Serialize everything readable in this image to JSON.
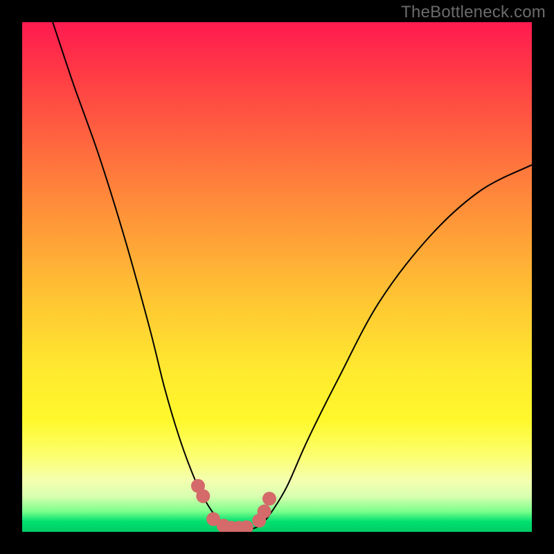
{
  "watermark": "TheBottleneck.com",
  "chart_data": {
    "type": "line",
    "title": "",
    "xlabel": "",
    "ylabel": "",
    "xlim": [
      0,
      100
    ],
    "ylim": [
      0,
      100
    ],
    "background_gradient": {
      "stops": [
        {
          "pos": 0.0,
          "color": "#ff1a50"
        },
        {
          "pos": 0.25,
          "color": "#ff6b3e"
        },
        {
          "pos": 0.55,
          "color": "#ffc733"
        },
        {
          "pos": 0.78,
          "color": "#fff82c"
        },
        {
          "pos": 0.93,
          "color": "#d9ffb0"
        },
        {
          "pos": 1.0,
          "color": "#00cc66"
        }
      ]
    },
    "series": [
      {
        "name": "left-curve",
        "x": [
          6,
          10,
          15,
          20,
          25,
          28,
          31,
          34,
          36,
          38,
          39.5,
          41,
          42.5
        ],
        "y": [
          100,
          88,
          74,
          58,
          40,
          28,
          18,
          10,
          6,
          3,
          1.5,
          0.8,
          0.5
        ],
        "stroke": "#000000",
        "width": 2.0
      },
      {
        "name": "right-curve",
        "x": [
          45,
          47,
          49,
          52,
          56,
          62,
          70,
          80,
          90,
          100
        ],
        "y": [
          0.5,
          1.5,
          4,
          9,
          18,
          30,
          45,
          58,
          67,
          72
        ],
        "stroke": "#000000",
        "width": 2.0
      },
      {
        "name": "valley-dots",
        "type": "scatter",
        "x": [
          34.5,
          35.5,
          37.5,
          39.5,
          41.0,
          42.5,
          44.0,
          46.5,
          47.5,
          48.5
        ],
        "y": [
          9.0,
          7.0,
          2.5,
          1.2,
          0.8,
          0.8,
          0.9,
          2.2,
          4.0,
          6.5
        ],
        "marker_color": "#d46a6a",
        "marker_radius": 10
      }
    ]
  }
}
